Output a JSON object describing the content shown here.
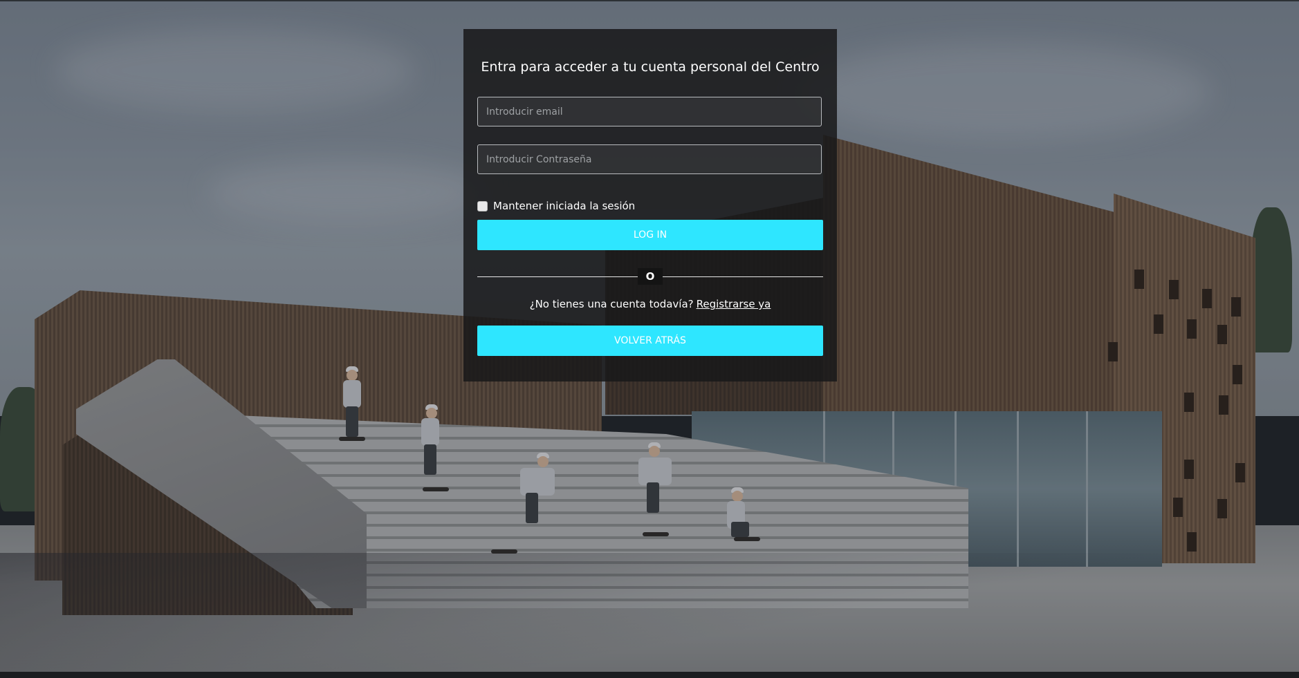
{
  "login": {
    "title": "Entra para acceder a tu cuenta personal del Centro",
    "email_placeholder": "Introducir email",
    "password_placeholder": "Introducir Contraseña",
    "remember_label": "Mantener iniciada la sesión",
    "login_button": "LOG IN",
    "divider_text": "O",
    "no_account_text": "¿No tienes una cuenta todavía?",
    "register_link": "Registrarse ya",
    "back_button": "VOLVER ATRÁS"
  },
  "colors": {
    "accent": "#2ee6ff",
    "card_background": "#18181a",
    "text": "#ffffff"
  },
  "icons": {
    "remember_checkbox": "checkbox-unchecked"
  }
}
